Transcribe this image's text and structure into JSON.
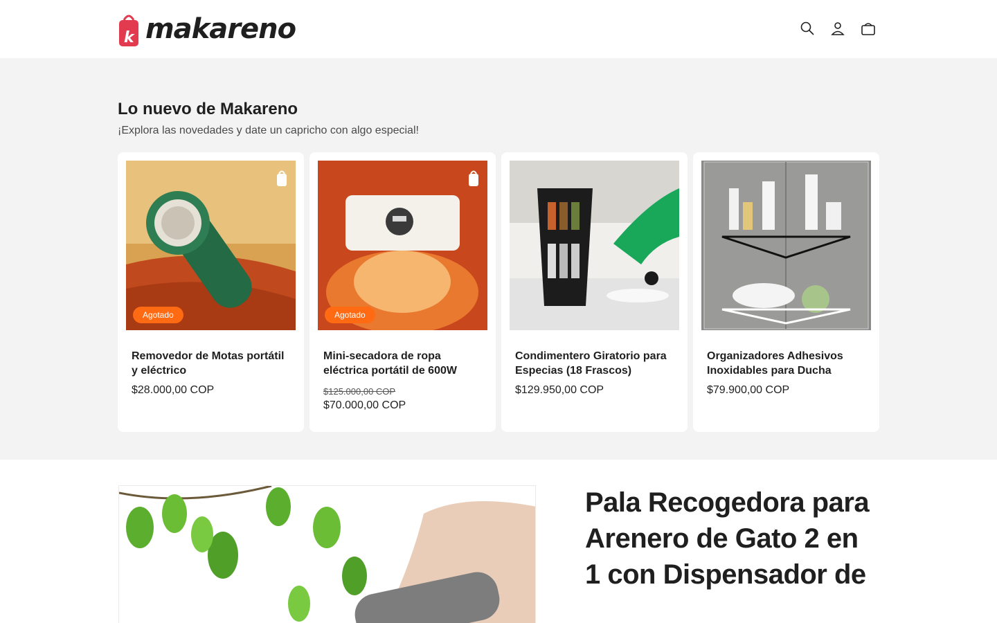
{
  "brand": {
    "name": "makareno",
    "accent": "#e23a4f"
  },
  "header": {
    "icons": [
      "search-icon",
      "account-icon",
      "cart-icon"
    ]
  },
  "new_section": {
    "title": "Lo nuevo de Makareno",
    "subtitle": "¡Explora las novedades y date un capricho con algo especial!",
    "products": [
      {
        "title": "Removedor de Motas portátil y eléctrico",
        "badge": "Agotado",
        "price": "$28.000,00 COP"
      },
      {
        "title": "Mini-secadora de ropa eléctrica portátil de 600W",
        "badge": "Agotado",
        "price_old": "$125.000,00 COP",
        "price": "$70.000,00 COP"
      },
      {
        "title": "Condimentero Giratorio para Especias (18 Frascos)",
        "price": "$129.950,00 COP"
      },
      {
        "title": "Organizadores Adhesivos Inoxidables para Ducha",
        "price": "$79.900,00 COP"
      }
    ]
  },
  "featured": {
    "title": "Pala Recogedora para Arenero de Gato 2 en 1 con Dispensador de"
  },
  "colors": {
    "badge": "#ff6a13",
    "section_bg": "#f3f3f3"
  }
}
